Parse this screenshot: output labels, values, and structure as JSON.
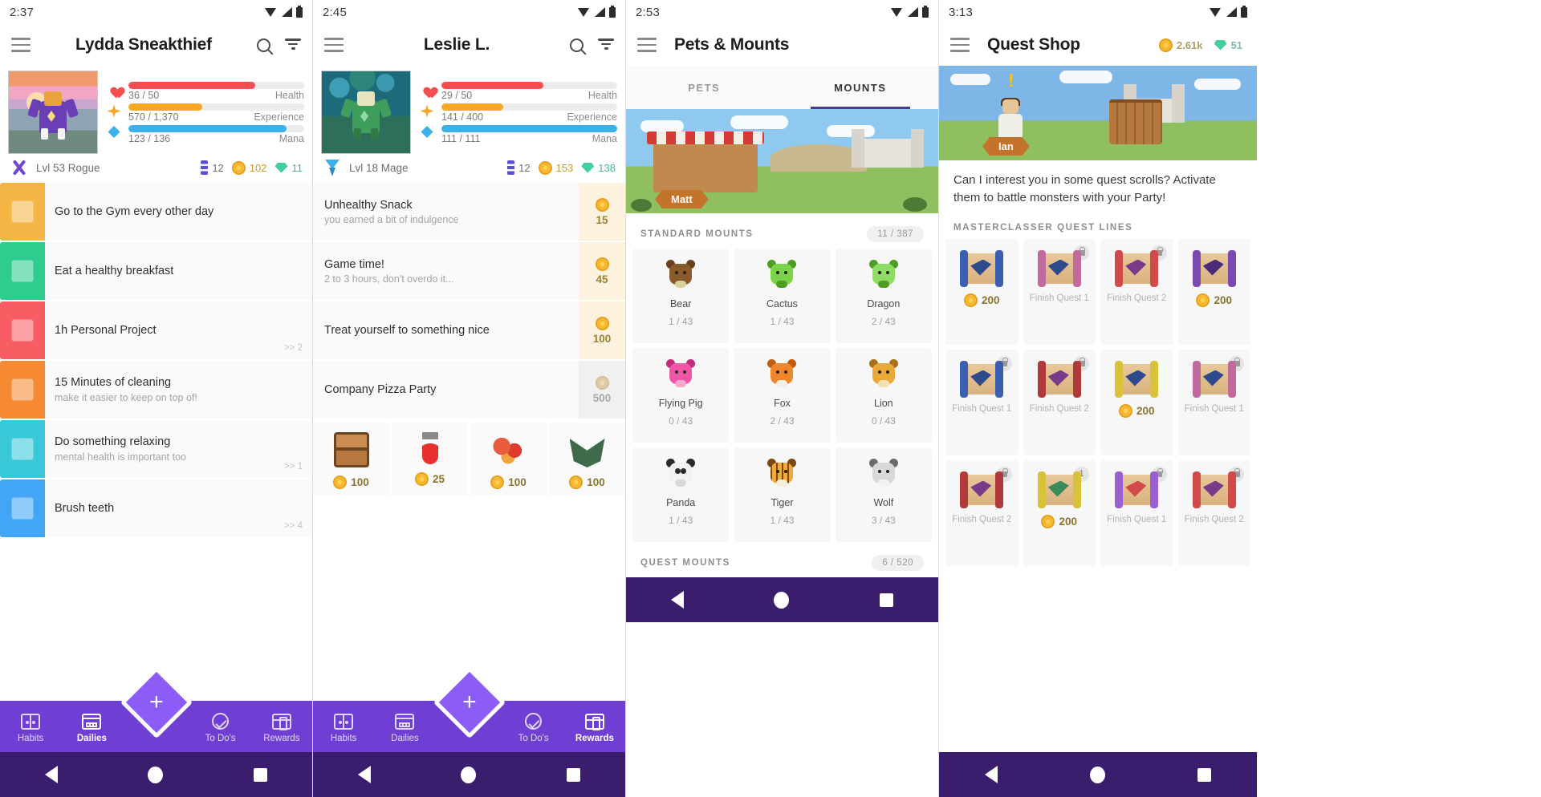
{
  "panels": [
    {
      "status": {
        "time": "2:37"
      },
      "appbar": {
        "title": "Lydda Sneakthief"
      },
      "user": {
        "health": {
          "label": "Health",
          "value": "36 / 50",
          "pct": 72
        },
        "experience": {
          "label": "Experience",
          "value": "570 / 1,370",
          "pct": 42
        },
        "mana": {
          "label": "Mana",
          "value": "123 / 136",
          "pct": 90
        },
        "class": "Lvl 53 Rogue",
        "level_stat": "12",
        "gold": "102",
        "gems": "11"
      },
      "tasks": [
        {
          "title": "Go to the Gym every other day",
          "sub": "",
          "streak": "",
          "color": "#f5b545"
        },
        {
          "title": "Eat a healthy breakfast",
          "sub": "",
          "streak": "",
          "color": "#2ecc8f"
        },
        {
          "title": "1h Personal Project",
          "sub": "",
          "streak": ">> 2",
          "color": "#f75d63"
        },
        {
          "title": "15 Minutes of cleaning",
          "sub": "make it easier to keep on top of!",
          "streak": "",
          "color": "#f58a33"
        },
        {
          "title": "Do something relaxing",
          "sub": "mental health is important too",
          "streak": ">> 1",
          "color": "#39c8d8"
        },
        {
          "title": "Brush teeth",
          "sub": "",
          "streak": ">> 4",
          "color": "#42a5f5"
        }
      ],
      "nav": {
        "fab": "+",
        "items": [
          {
            "label": "Habits",
            "icon": "habits-icon",
            "active": false
          },
          {
            "label": "Dailies",
            "icon": "dailies-icon",
            "active": true
          },
          {
            "label": "To Do's",
            "icon": "todos-icon",
            "active": false
          },
          {
            "label": "Rewards",
            "icon": "rewards-icon",
            "active": false
          }
        ]
      }
    },
    {
      "status": {
        "time": "2:45"
      },
      "appbar": {
        "title": "Leslie L."
      },
      "user": {
        "health": {
          "label": "Health",
          "value": "29 / 50",
          "pct": 58
        },
        "experience": {
          "label": "Experience",
          "value": "141 / 400",
          "pct": 35
        },
        "mana": {
          "label": "Mana",
          "value": "111 / 111",
          "pct": 100
        },
        "class": "Lvl 18 Mage",
        "level_stat": "12",
        "gold": "153",
        "gems": "138"
      },
      "rewards": [
        {
          "title": "Unhealthy Snack",
          "sub": "you earned a bit of indulgence",
          "price": "15",
          "affordable": true
        },
        {
          "title": "Game time!",
          "sub": "2 to 3 hours, don't overdo it...",
          "price": "45",
          "affordable": true
        },
        {
          "title": "Treat yourself to something nice",
          "sub": "",
          "price": "100",
          "affordable": true
        },
        {
          "title": "Company Pizza Party",
          "sub": "",
          "price": "500",
          "affordable": false
        }
      ],
      "items": [
        {
          "name": "treasure-chest",
          "cost": "100"
        },
        {
          "name": "health-potion",
          "cost": "25"
        },
        {
          "name": "food-item",
          "cost": "100"
        },
        {
          "name": "armor-item",
          "cost": "100"
        }
      ],
      "nav": {
        "fab": "+",
        "items": [
          {
            "label": "Habits",
            "icon": "habits-icon",
            "active": false
          },
          {
            "label": "Dailies",
            "icon": "dailies-icon",
            "active": false
          },
          {
            "label": "To Do's",
            "icon": "todos-icon",
            "active": false
          },
          {
            "label": "Rewards",
            "icon": "rewards-icon",
            "active": true
          }
        ]
      }
    },
    {
      "status": {
        "time": "2:53"
      },
      "appbar": {
        "title": "Pets & Mounts"
      },
      "tabs": [
        {
          "label": "PETS",
          "active": false
        },
        {
          "label": "MOUNTS",
          "active": true
        }
      ],
      "banner": {
        "name_pill": "Matt"
      },
      "sections": [
        {
          "title": "STANDARD MOUNTS",
          "count": "11 / 387"
        },
        {
          "title": "QUEST MOUNTS",
          "count": "6 / 520"
        }
      ],
      "mounts": [
        {
          "name": "Bear",
          "count": "1 / 43",
          "color": "#8a5a2b",
          "accent": "#6b3f1c"
        },
        {
          "name": "Cactus",
          "count": "1 / 43",
          "color": "#7ad44a",
          "accent": "#4f9c22"
        },
        {
          "name": "Dragon",
          "count": "2 / 43",
          "color": "#8ddc63",
          "accent": "#4f9c22"
        },
        {
          "name": "Flying Pig",
          "count": "0 / 43",
          "color": "#f056a8",
          "accent": "#c22c7c"
        },
        {
          "name": "Fox",
          "count": "2 / 43",
          "color": "#f0862c",
          "accent": "#c05c12"
        },
        {
          "name": "Lion",
          "count": "0 / 43",
          "color": "#e8a93a",
          "accent": "#a8701a"
        },
        {
          "name": "Panda",
          "count": "1 / 43",
          "color": "#f2f2f2",
          "accent": "#2b2b2b"
        },
        {
          "name": "Tiger",
          "count": "1 / 43",
          "color": "#f0a93a",
          "accent": "#7a4a12"
        },
        {
          "name": "Wolf",
          "count": "3 / 43",
          "color": "#d8d8d8",
          "accent": "#6a6a6a"
        }
      ]
    },
    {
      "status": {
        "time": "3:13"
      },
      "appbar": {
        "title": "Quest Shop",
        "gold": "2.61k",
        "gems": "51"
      },
      "banner": {
        "name_pill": "Ian"
      },
      "description": "Can I interest you in some quest scrolls? Activate them to battle monsters with your Party!",
      "section": {
        "title": "MASTERCLASSER QUEST LINES"
      },
      "quests": [
        {
          "price": "200",
          "label": "",
          "badge": "none",
          "roll": "#3a5fb0"
        },
        {
          "price": "",
          "label": "Finish Quest 1",
          "badge": "lock",
          "roll": "#c06a9e"
        },
        {
          "price": "",
          "label": "Finish Quest 2",
          "badge": "lock",
          "roll": "#d04a4a"
        },
        {
          "price": "200",
          "label": "",
          "badge": "none",
          "roll": "#7a4ab0"
        },
        {
          "price": "",
          "label": "Finish Quest 1",
          "badge": "lock",
          "roll": "#3a5fb0"
        },
        {
          "price": "",
          "label": "Finish Quest 2",
          "badge": "lock",
          "roll": "#b03a3a"
        },
        {
          "price": "200",
          "label": "",
          "badge": "none",
          "roll": "#d8c23a"
        },
        {
          "price": "",
          "label": "Finish Quest 1",
          "badge": "lock",
          "roll": "#c06a9e"
        },
        {
          "price": "",
          "label": "Finish Quest 2",
          "badge": "lock",
          "roll": "#b03a3a"
        },
        {
          "price": "200",
          "label": "",
          "badge": "1",
          "roll": "#d8c23a"
        },
        {
          "price": "",
          "label": "Finish Quest 1",
          "badge": "lock",
          "roll": "#9a5fd0"
        },
        {
          "price": "",
          "label": "Finish Quest 2",
          "badge": "lock",
          "roll": "#d04a4a"
        }
      ]
    }
  ],
  "colors": {
    "brand_purple": "#6f3fd4",
    "fab_purple": "#8b5cf6",
    "health_red": "#f74e52",
    "xp_orange": "#f9a826",
    "mana_blue": "#3cb0e8",
    "gold": "#f7b733",
    "gem_green": "#43cf9a"
  }
}
